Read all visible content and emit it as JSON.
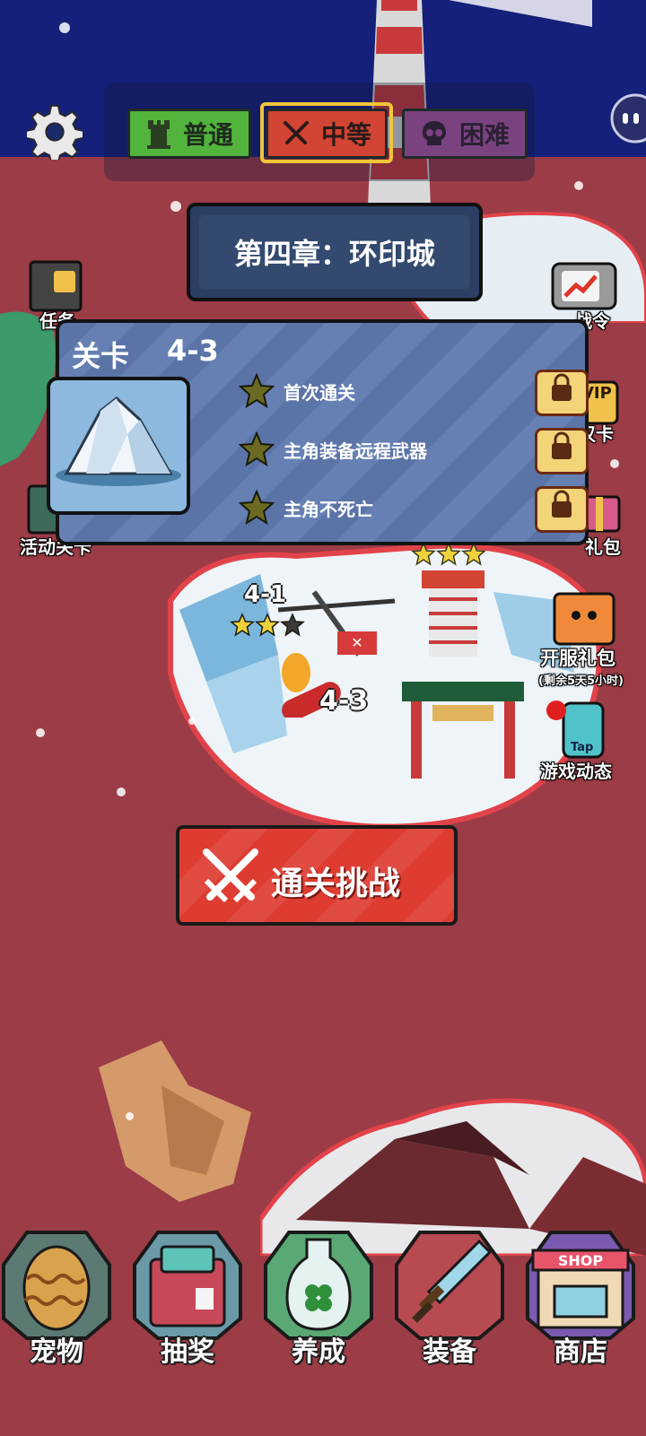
{
  "difficulty": {
    "easy_label": "普通",
    "mid_label": "中等",
    "hard_label": "困难",
    "selected": "中等"
  },
  "chapter": {
    "title": "第四章：环印城"
  },
  "level_panel": {
    "title": "关卡",
    "level": "4-3",
    "requirements": [
      {
        "label": "首次通关"
      },
      {
        "label": "主角装备远程武器"
      },
      {
        "label": "主角不死亡"
      }
    ]
  },
  "side_left": {
    "task_label": "任务",
    "activity_label": "活动关卡"
  },
  "side_right": {
    "battlepass_label": "战令",
    "vip_label": "VIP",
    "vipcard_label": "汉卡",
    "gift_label": "礼包",
    "server_gift_label": "开服礼包",
    "server_gift_timer": "(剩余5天5小时)",
    "game_news_label": "游戏动态",
    "tap_text": "Tap"
  },
  "map": {
    "level_4_1": "4-1",
    "level_4_3": "4-3",
    "level_4_1_stars": 2
  },
  "challenge_button": {
    "label": "通关挑战"
  },
  "bottom_nav": {
    "items": [
      {
        "label": "宠物",
        "icon": "egg-icon"
      },
      {
        "label": "抽奖",
        "icon": "lootbox-icon"
      },
      {
        "label": "养成",
        "icon": "bottle-clover-icon"
      },
      {
        "label": "装备",
        "icon": "sword-icon"
      },
      {
        "label": "商店",
        "icon": "shop-icon"
      }
    ],
    "shop_sign": "SHOP"
  },
  "colors": {
    "easy": "#52b43c",
    "medium": "#d24433",
    "hard": "#7a4380",
    "ground": "#9c3c46",
    "sky": "#15207a"
  }
}
